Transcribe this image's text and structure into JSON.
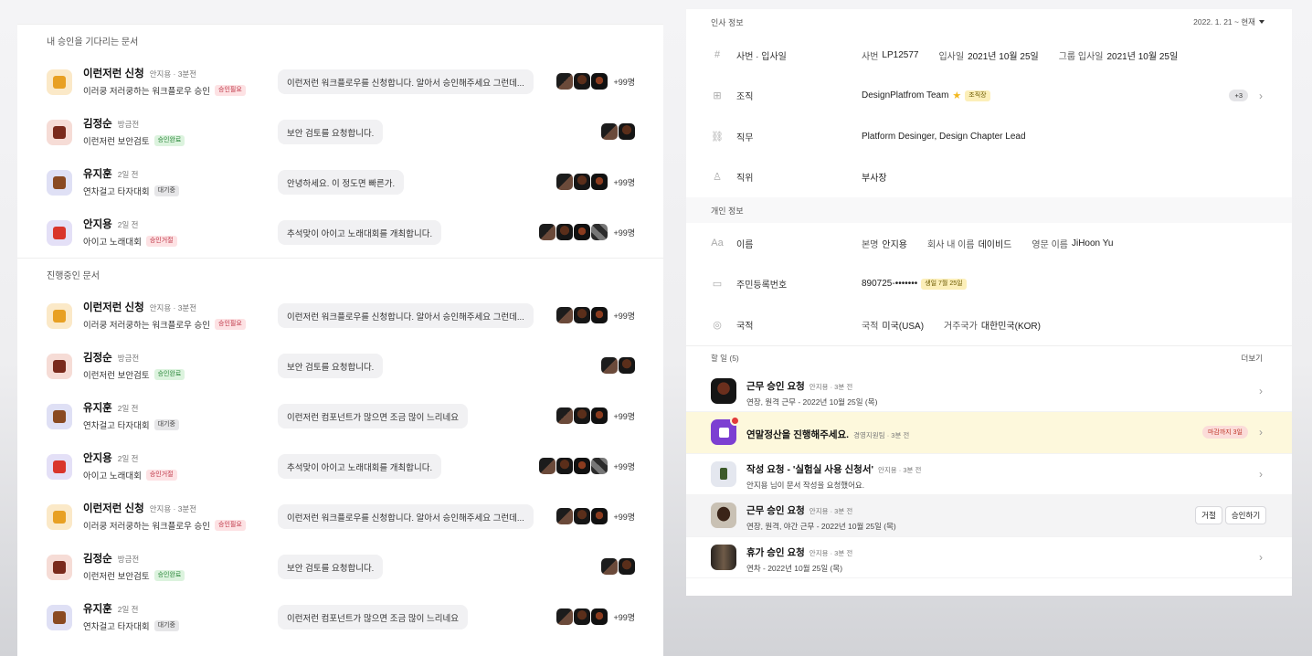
{
  "left": {
    "sections": [
      {
        "title": "내 승인을 기다리는 문서",
        "rows": [
          {
            "icon": "crown-icon",
            "icon_tone": "crown",
            "title": "이런저런 신청",
            "meta": "안지용 · 3분전",
            "sub": "이러쿵 저러쿵하는 워크플로우 승인",
            "badge": "승인필요",
            "badge_tone": "red",
            "message": "이런저런 워크플로우를 신청합니다. 알아서 승인해주세요 그런데...",
            "avatars": [
              "a1",
              "a2",
              "a3"
            ],
            "more": "+99명"
          },
          {
            "icon": "shield-icon",
            "icon_tone": "shield",
            "title": "김정순",
            "meta": "방금전",
            "sub": "이런저런 보안검토",
            "badge": "승인완료",
            "badge_tone": "green",
            "message": "보안 검토를 요청합니다.",
            "avatars": [
              "a1",
              "a2"
            ],
            "more": ""
          },
          {
            "icon": "coffee-icon",
            "icon_tone": "coffee",
            "title": "유지훈",
            "meta": "2일 전",
            "sub": "연차걸고 타자대회",
            "badge": "대기중",
            "badge_tone": "gray",
            "message": "안녕하세요. 이 정도면 빠른가.",
            "avatars": [
              "a1",
              "a2",
              "a3"
            ],
            "more": "+99명"
          },
          {
            "icon": "microphone-icon",
            "icon_tone": "mic",
            "title": "안지용",
            "meta": "2일 전",
            "sub": "아이고 노래대회",
            "badge": "승인거절",
            "badge_tone": "red",
            "message": "추석맞이 아이고 노래대회를 개최합니다.",
            "avatars": [
              "a1",
              "a2",
              "a3",
              "a4"
            ],
            "more": "+99명"
          }
        ]
      },
      {
        "title": "진행중인 문서",
        "rows": [
          {
            "icon": "crown-icon",
            "icon_tone": "crown",
            "title": "이런저런 신청",
            "meta": "안지용 · 3분전",
            "sub": "이러쿵 저러쿵하는 워크플로우 승인",
            "badge": "승인필요",
            "badge_tone": "red",
            "message": "이런저런 워크플로우를 신청합니다. 알아서 승인해주세요 그런데...",
            "avatars": [
              "a1",
              "a2",
              "a3"
            ],
            "more": "+99명"
          },
          {
            "icon": "shield-icon",
            "icon_tone": "shield",
            "title": "김정순",
            "meta": "방금전",
            "sub": "이런저런 보안검토",
            "badge": "승인완료",
            "badge_tone": "green",
            "message": "보안 검토를 요청합니다.",
            "avatars": [
              "a1",
              "a2"
            ],
            "more": ""
          },
          {
            "icon": "coffee-icon",
            "icon_tone": "coffee",
            "title": "유지훈",
            "meta": "2일 전",
            "sub": "연차걸고 타자대회",
            "badge": "대기중",
            "badge_tone": "gray",
            "message": "이런저런 컴포넌트가 많으면 조금 많이 느리네요",
            "avatars": [
              "a1",
              "a2",
              "a3"
            ],
            "more": "+99명"
          },
          {
            "icon": "microphone-icon",
            "icon_tone": "mic",
            "title": "안지용",
            "meta": "2일 전",
            "sub": "아이고 노래대회",
            "badge": "승인거절",
            "badge_tone": "red",
            "message": "추석맞이 아이고 노래대회를 개최합니다.",
            "avatars": [
              "a1",
              "a2",
              "a3",
              "a4"
            ],
            "more": "+99명"
          },
          {
            "icon": "crown-icon",
            "icon_tone": "crown",
            "title": "이런저런 신청",
            "meta": "안지용 · 3분전",
            "sub": "이러쿵 저러쿵하는 워크플로우 승인",
            "badge": "승인필요",
            "badge_tone": "red",
            "message": "이런저런 워크플로우를 신청합니다. 알아서 승인해주세요 그런데...",
            "avatars": [
              "a1",
              "a2",
              "a3"
            ],
            "more": "+99명"
          },
          {
            "icon": "shield-icon",
            "icon_tone": "shield",
            "title": "김정순",
            "meta": "방금전",
            "sub": "이런저런 보안검토",
            "badge": "승인완료",
            "badge_tone": "green",
            "message": "보안 검토를 요청합니다.",
            "avatars": [
              "a1",
              "a2"
            ],
            "more": ""
          },
          {
            "icon": "coffee-icon",
            "icon_tone": "coffee",
            "title": "유지훈",
            "meta": "2일 전",
            "sub": "연차걸고 타자대회",
            "badge": "대기중",
            "badge_tone": "gray",
            "message": "이런저런 컴포넌트가 많으면 조금 많이 느리네요",
            "avatars": [
              "a1",
              "a2",
              "a3"
            ],
            "more": "+99명"
          }
        ]
      }
    ]
  },
  "right": {
    "hr_section": {
      "title": "인사 정보",
      "period": "2022. 1. 21 ~ 현재",
      "rows": [
        {
          "icon": "hash-icon",
          "glyph": "#",
          "label": "사번 · 입사일",
          "parts": [
            [
              "사번",
              "LP12577"
            ],
            [
              "입사일",
              "2021년 10월 25일"
            ],
            [
              "그룹 입사일",
              "2021년 10월 25일"
            ]
          ]
        },
        {
          "icon": "org-chart-icon",
          "glyph": "⊞",
          "label": "조직",
          "value": "DesignPlatfrom Team",
          "badge": "조직장",
          "count": "+3"
        },
        {
          "icon": "job-icon",
          "glyph": "⛓",
          "label": "직무",
          "value": "Platform Desinger, Design Chapter Lead"
        },
        {
          "icon": "position-icon",
          "glyph": "♙",
          "label": "직위",
          "value": "부사장"
        }
      ]
    },
    "personal_section": {
      "title": "개인 정보",
      "rows": [
        {
          "icon": "text-icon",
          "glyph": "Aa",
          "label": "이름",
          "parts": [
            [
              "본명",
              "안지용"
            ],
            [
              "회사 내 이름",
              "데이비드"
            ],
            [
              "영문 이름",
              "JiHoon Yu"
            ]
          ]
        },
        {
          "icon": "id-card-icon",
          "glyph": "▭",
          "label": "주민등록번호",
          "value": "890725-•••••••",
          "badge": "생일 7월 25일"
        },
        {
          "icon": "globe-icon",
          "glyph": "◎",
          "label": "국적",
          "parts": [
            [
              "국적",
              "미국(USA)"
            ],
            [
              "거주국가",
              "대한민국(KOR)"
            ]
          ]
        }
      ]
    },
    "todo": {
      "title": "할 일 (5)",
      "more_label": "더보기",
      "items": [
        {
          "icon": "profile-dark-icon",
          "tone": "ti-dark",
          "title": "근무 승인 요청",
          "meta": "안지용 · 3분 전",
          "sub": "연장, 원격 근무 - 2022년 10월 25일 (목)",
          "style": ""
        },
        {
          "icon": "calculator-icon",
          "tone": "ti-purple",
          "title": "연말정산을 진행해주세요.",
          "meta": "경영지원팀 · 3분 전",
          "sub": "",
          "deadline": "마감까지 3일",
          "style": "hl"
        },
        {
          "icon": "document-icon",
          "tone": "ti-green",
          "title": "작성 요청 - '실험실 사용 신청서'",
          "meta": "안지용 · 3분 전",
          "sub": "안지용 님이 문서 작성을 요청했어요.",
          "style": ""
        },
        {
          "icon": "profile-portrait-icon",
          "tone": "ti-portrait",
          "title": "근무 승인 요청",
          "meta": "안지용 · 3분 전",
          "sub": "연장, 원격, 야간 근무 - 2022년 10월 25일 (목)",
          "buttons": [
            "거절",
            "승인하기"
          ],
          "style": "gray"
        },
        {
          "icon": "profile-portrait-icon",
          "tone": "ti-portrait2",
          "title": "휴가 승인 요청",
          "meta": "안지용 · 3분 전",
          "sub": "연차 - 2022년 10월 25일 (목)",
          "style": ""
        }
      ]
    }
  }
}
